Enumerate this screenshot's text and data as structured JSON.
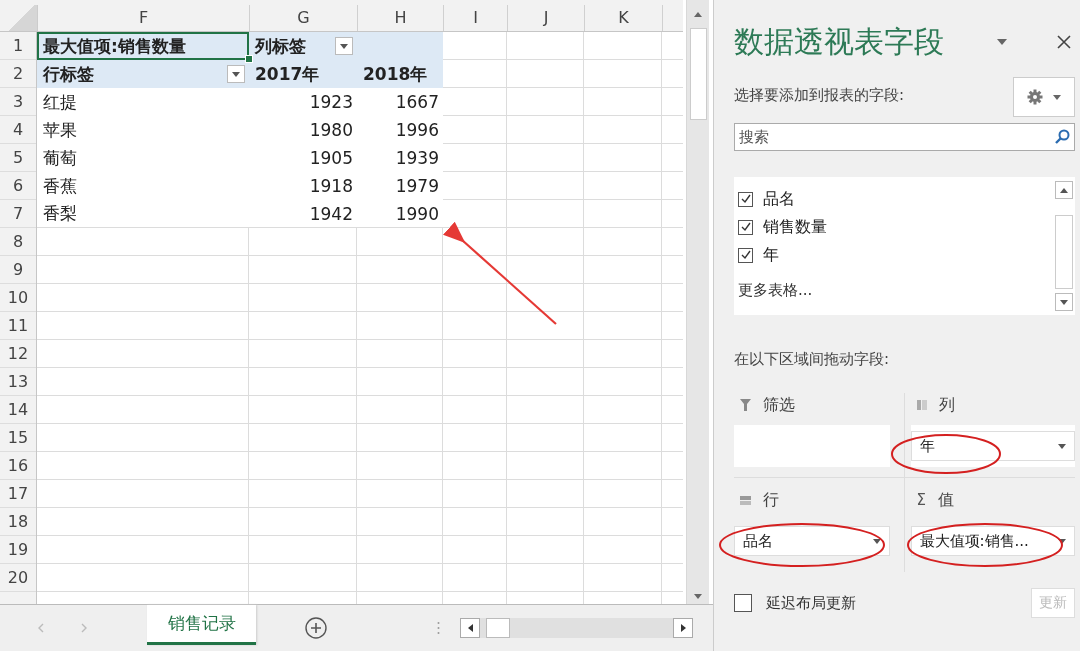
{
  "sheet": {
    "columns": [
      "F",
      "G",
      "H",
      "I",
      "J",
      "K"
    ],
    "row_numbers": [
      "1",
      "2",
      "3",
      "4",
      "5",
      "6",
      "7",
      "8",
      "9",
      "10",
      "11",
      "12",
      "13",
      "14",
      "15",
      "16",
      "17",
      "18",
      "19",
      "20"
    ],
    "pivot": {
      "corner": "最大值项:销售数量",
      "column_label": "列标签",
      "row_label": "行标签",
      "years": [
        "2017年",
        "2018年"
      ],
      "rows": [
        {
          "name": "红提",
          "values": [
            "1923",
            "1667"
          ]
        },
        {
          "name": "苹果",
          "values": [
            "1980",
            "1996"
          ]
        },
        {
          "name": "葡萄",
          "values": [
            "1905",
            "1939"
          ]
        },
        {
          "name": "香蕉",
          "values": [
            "1918",
            "1979"
          ]
        },
        {
          "name": "香梨",
          "values": [
            "1942",
            "1990"
          ]
        }
      ]
    }
  },
  "sheet_tabs": [
    {
      "label": "销售记录",
      "selected": true
    }
  ],
  "panel": {
    "title": "数据透视表字段",
    "subtitle": "选择要添加到报表的字段:",
    "search": {
      "placeholder": "搜索"
    },
    "fields": [
      {
        "label": "品名",
        "checked": true
      },
      {
        "label": "销售数量",
        "checked": true
      },
      {
        "label": "年",
        "checked": true
      }
    ],
    "more_tables": "更多表格...",
    "areas_label": "在以下区域间拖动字段:",
    "areas": [
      {
        "kind": "filter",
        "label": "筛选"
      },
      {
        "kind": "columns",
        "label": "列",
        "items": [
          "年"
        ]
      },
      {
        "kind": "rows",
        "label": "行",
        "items": [
          "品名"
        ]
      },
      {
        "kind": "values",
        "label": "值",
        "icon": "Σ",
        "items": [
          "最大值项:销售..."
        ]
      }
    ],
    "defer": {
      "label": "延迟布局更新",
      "checked": false
    },
    "update_button": {
      "label": "更新",
      "disabled": true
    }
  }
}
